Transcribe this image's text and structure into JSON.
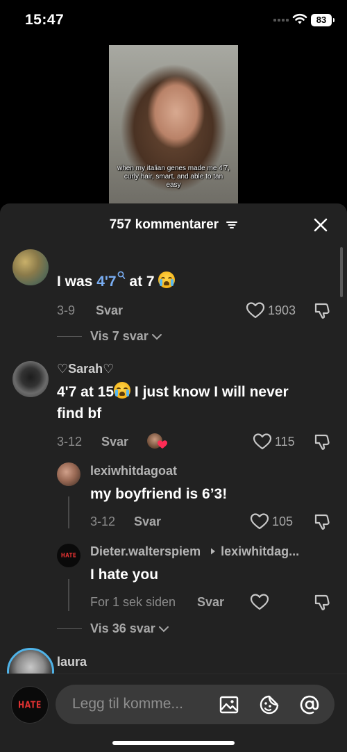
{
  "status_bar": {
    "time": "15:47",
    "battery": "83"
  },
  "video": {
    "caption": "when my italian genes made me 4'7, curly hair, smart, and able to tan easy"
  },
  "sheet": {
    "title": "757 kommentarer"
  },
  "comments": [
    {
      "username": "",
      "text_before": "I was ",
      "text_highlight": "4'7",
      "text_after": " at 7 ",
      "date": "3-9",
      "reply_label": "Svar",
      "likes": "1903",
      "view_replies": "Vis 7 svar"
    },
    {
      "username": "♡Sarah♡",
      "text_line1_a": "4'7 at 15",
      "text_line1_b": " I just know I will never",
      "text_line2": "find bf",
      "date": "3-12",
      "reply_label": "Svar",
      "likes": "115",
      "replies": [
        {
          "username": "lexiwhitdagoat",
          "text": "my boyfriend is 6’3!",
          "date": "3-12",
          "reply_label": "Svar",
          "likes": "105"
        },
        {
          "username": "Dieter.walterspiem",
          "reply_to": "lexiwhitdag...",
          "avatar_text": "HATE",
          "text": "I hate you",
          "date": "For 1 sek siden",
          "reply_label": "Svar"
        }
      ],
      "view_replies": "Vis 36 svar"
    },
    {
      "username": "laura"
    }
  ],
  "input_bar": {
    "avatar_text": "HATE",
    "placeholder": "Legg til komme..."
  },
  "colors": {
    "sheet_bg": "#222222",
    "highlight": "#7aaef3",
    "muted": "#a8a8a8",
    "input_bg": "#3a3a3a",
    "liked_heart": "#fe2c55"
  },
  "icons": [
    "wifi-icon",
    "battery-icon",
    "sort-icon",
    "close-icon",
    "heart-icon",
    "dislike-icon",
    "chevron-down-icon",
    "image-icon",
    "emoji-icon",
    "mention-icon",
    "search-icon"
  ]
}
